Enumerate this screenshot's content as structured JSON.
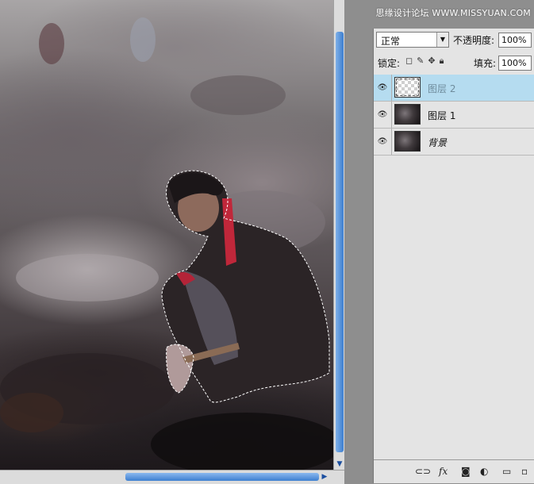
{
  "watermark": "思缘设计论坛 WWW.MISSYUAN.COM",
  "blend_mode": {
    "value": "正常",
    "arrow_icon": "chevron-down-icon"
  },
  "opacity": {
    "label": "不透明度:",
    "value": "100%"
  },
  "lock": {
    "label": "锁定:",
    "icons": [
      "lock-transparent-icon",
      "lock-paint-icon",
      "lock-move-icon",
      "lock-all-icon"
    ]
  },
  "fill": {
    "label": "填充:",
    "value": "100%"
  },
  "layers": [
    {
      "name": "图层 2",
      "visible": true,
      "selected": true,
      "thumb": "transparent"
    },
    {
      "name": "图层 1",
      "visible": true,
      "selected": false,
      "thumb": "photo"
    },
    {
      "name": "背景",
      "visible": true,
      "selected": false,
      "thumb": "photo",
      "italic": true
    }
  ],
  "bottom_icons": [
    "link-icon",
    "fx-icon",
    "mask-icon",
    "adjustment-icon",
    "group-icon",
    "new-layer-icon"
  ]
}
